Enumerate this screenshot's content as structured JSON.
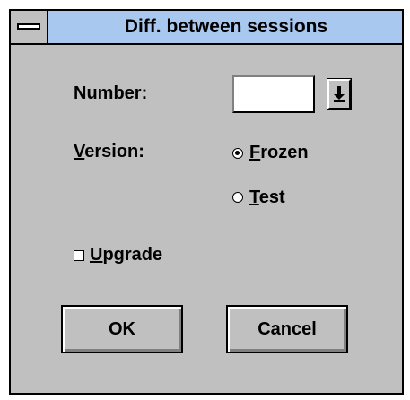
{
  "window": {
    "title": "Diff. between sessions"
  },
  "fields": {
    "number_label": "Number:",
    "number_value": "",
    "version_label_underlined": "V",
    "version_label_rest": "ersion:"
  },
  "version_options": [
    {
      "underlined": "F",
      "rest": "rozen",
      "selected": true
    },
    {
      "underlined": "T",
      "rest": "est",
      "selected": false
    }
  ],
  "upgrade": {
    "underlined": "U",
    "rest": "pgrade",
    "checked": false
  },
  "buttons": {
    "ok_label": "OK",
    "cancel_label": "Cancel"
  },
  "icons": {
    "system_menu": "system-menu-icon",
    "dropdown": "dropdown-arrow-icon"
  },
  "colors": {
    "titlebar": "#a8c8f0",
    "dialog_bg": "#c0c0c0"
  }
}
